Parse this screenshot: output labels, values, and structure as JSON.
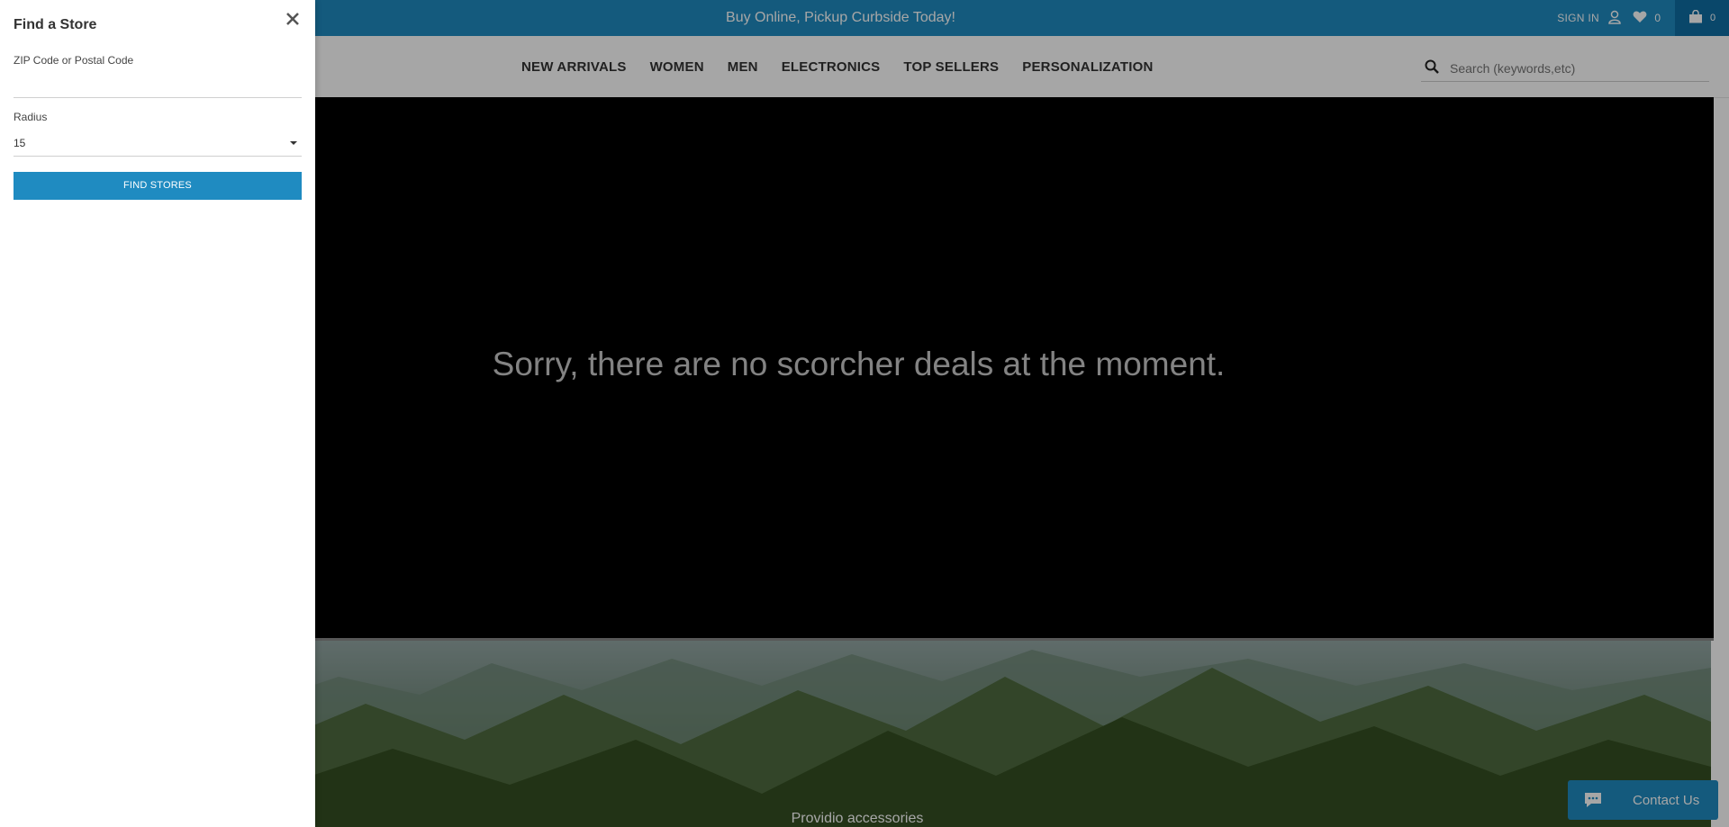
{
  "promo": {
    "text": "Buy Online, Pickup Curbside Today!"
  },
  "header": {
    "sign_in": "SIGN IN",
    "wishlist_count": "0",
    "cart_count": "0",
    "search_placeholder": "Search (keywords,etc)"
  },
  "nav": {
    "items": [
      "NEW ARRIVALS",
      "WOMEN",
      "MEN",
      "ELECTRONICS",
      "TOP SELLERS",
      "PERSONALIZATION"
    ]
  },
  "hero": {
    "message": "Sorry, there are no scorcher deals at the moment."
  },
  "banner": {
    "caption": "Providio accessories"
  },
  "contact": {
    "label": "Contact Us"
  },
  "drawer": {
    "title": "Find a Store",
    "zip_label": "ZIP Code or Postal Code",
    "zip_value": "",
    "radius_label": "Radius",
    "radius_value": "15",
    "find_button": "FIND STORES"
  },
  "colors": {
    "brand_blue": "#1f8bc1",
    "cart_blue": "#0f6da4",
    "hero_bg": "#000000",
    "hero_text": "#c9c9c9"
  },
  "icons": [
    "close-icon",
    "user-icon",
    "heart-icon",
    "bag-icon",
    "search-icon",
    "chevron-down-icon",
    "chat-icon"
  ]
}
